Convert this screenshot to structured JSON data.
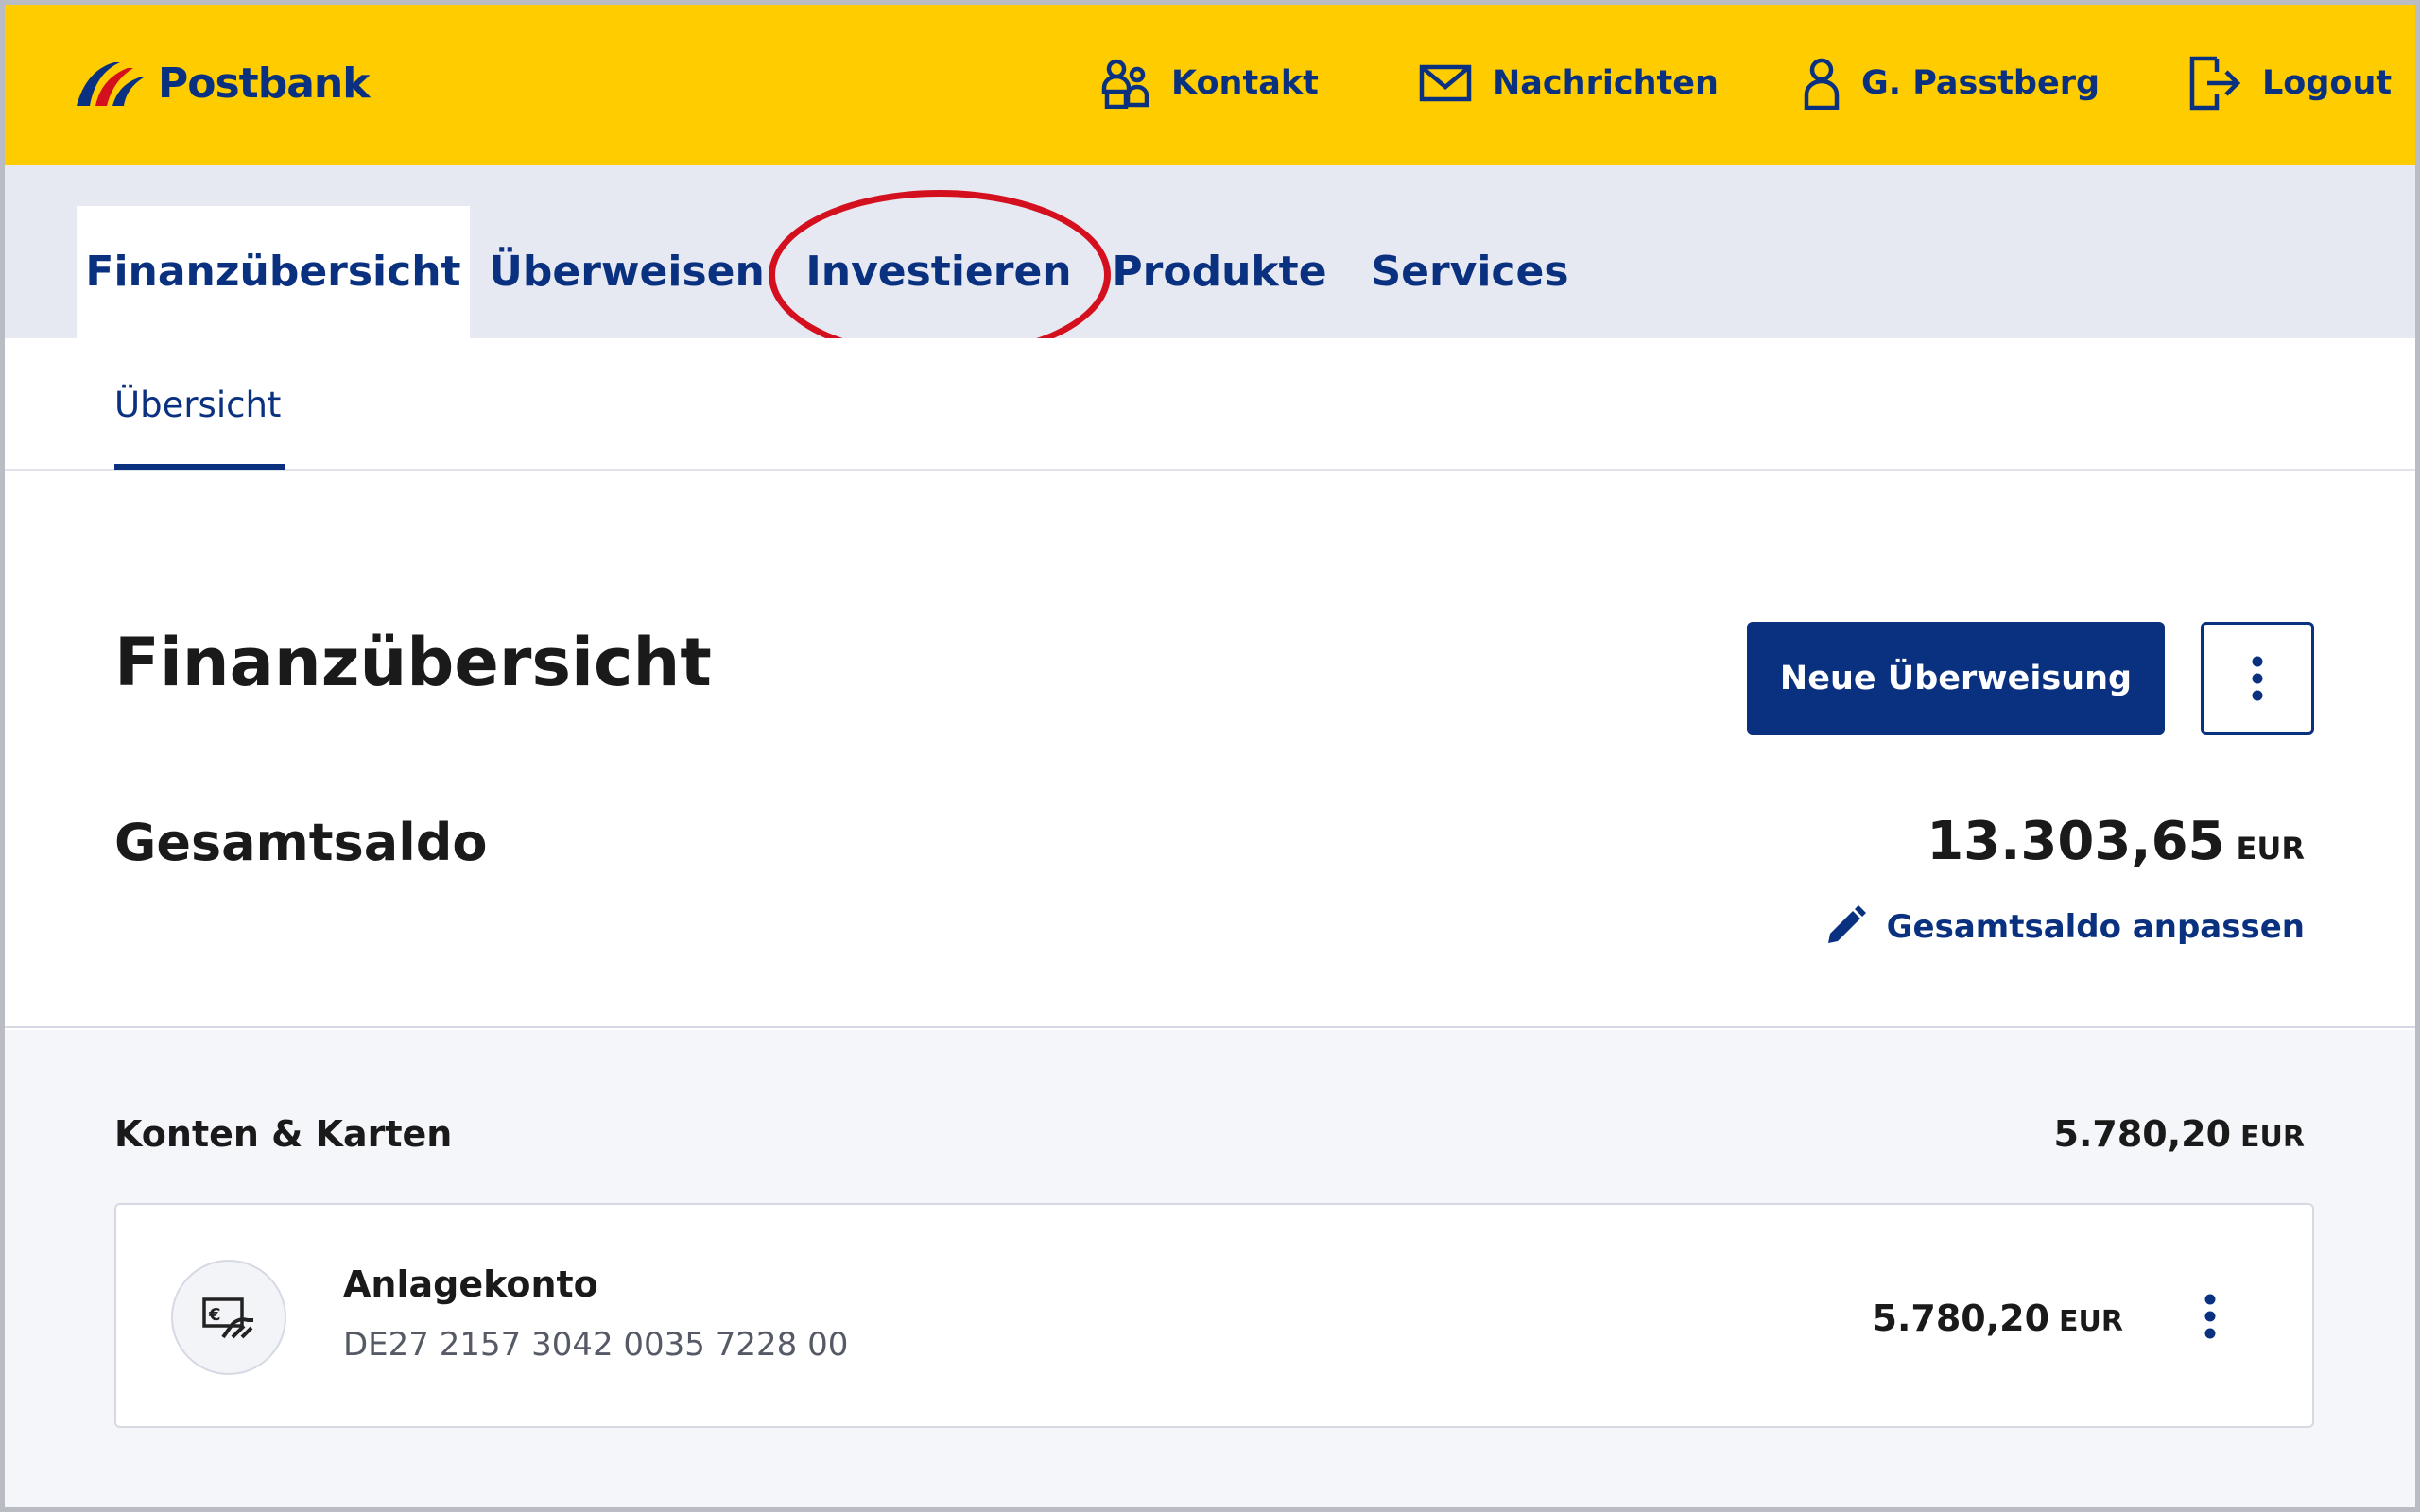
{
  "brand": {
    "name": "Postbank",
    "color_primary": "#0a3180",
    "color_yellow": "#ffcc00",
    "color_highlight": "#d4101f"
  },
  "top_nav": {
    "contact": {
      "label": "Kontakt",
      "icon": "contact-people-icon"
    },
    "messages": {
      "label": "Nachrichten",
      "icon": "envelope-icon"
    },
    "user": {
      "label": "G. Passtberg",
      "icon": "user-icon"
    },
    "logout": {
      "label": "Logout",
      "icon": "logout-icon"
    }
  },
  "main_nav": {
    "tabs": [
      {
        "label": "Finanzübersicht",
        "active": true
      },
      {
        "label": "Überweisen",
        "active": false
      },
      {
        "label": "Investieren",
        "active": false,
        "highlighted": true
      },
      {
        "label": "Produkte",
        "active": false
      },
      {
        "label": "Services",
        "active": false
      }
    ]
  },
  "sub_nav": {
    "tabs": [
      {
        "label": "Übersicht",
        "active": true
      }
    ]
  },
  "overview": {
    "title": "Finanzübersicht",
    "new_transfer_label": "Neue Überweisung",
    "total_label": "Gesamtsaldo",
    "total_amount": "13.303,65",
    "total_currency": "EUR",
    "adjust_label": "Gesamtsaldo anpassen"
  },
  "accounts": {
    "section_label": "Konten & Karten",
    "section_amount": "5.780,20",
    "section_currency": "EUR",
    "items": [
      {
        "name": "Anlagekonto",
        "iban": "DE27 2157 3042 0035 7228 00",
        "amount": "5.780,20",
        "currency": "EUR",
        "icon": "euro-card-hand-icon"
      }
    ]
  }
}
